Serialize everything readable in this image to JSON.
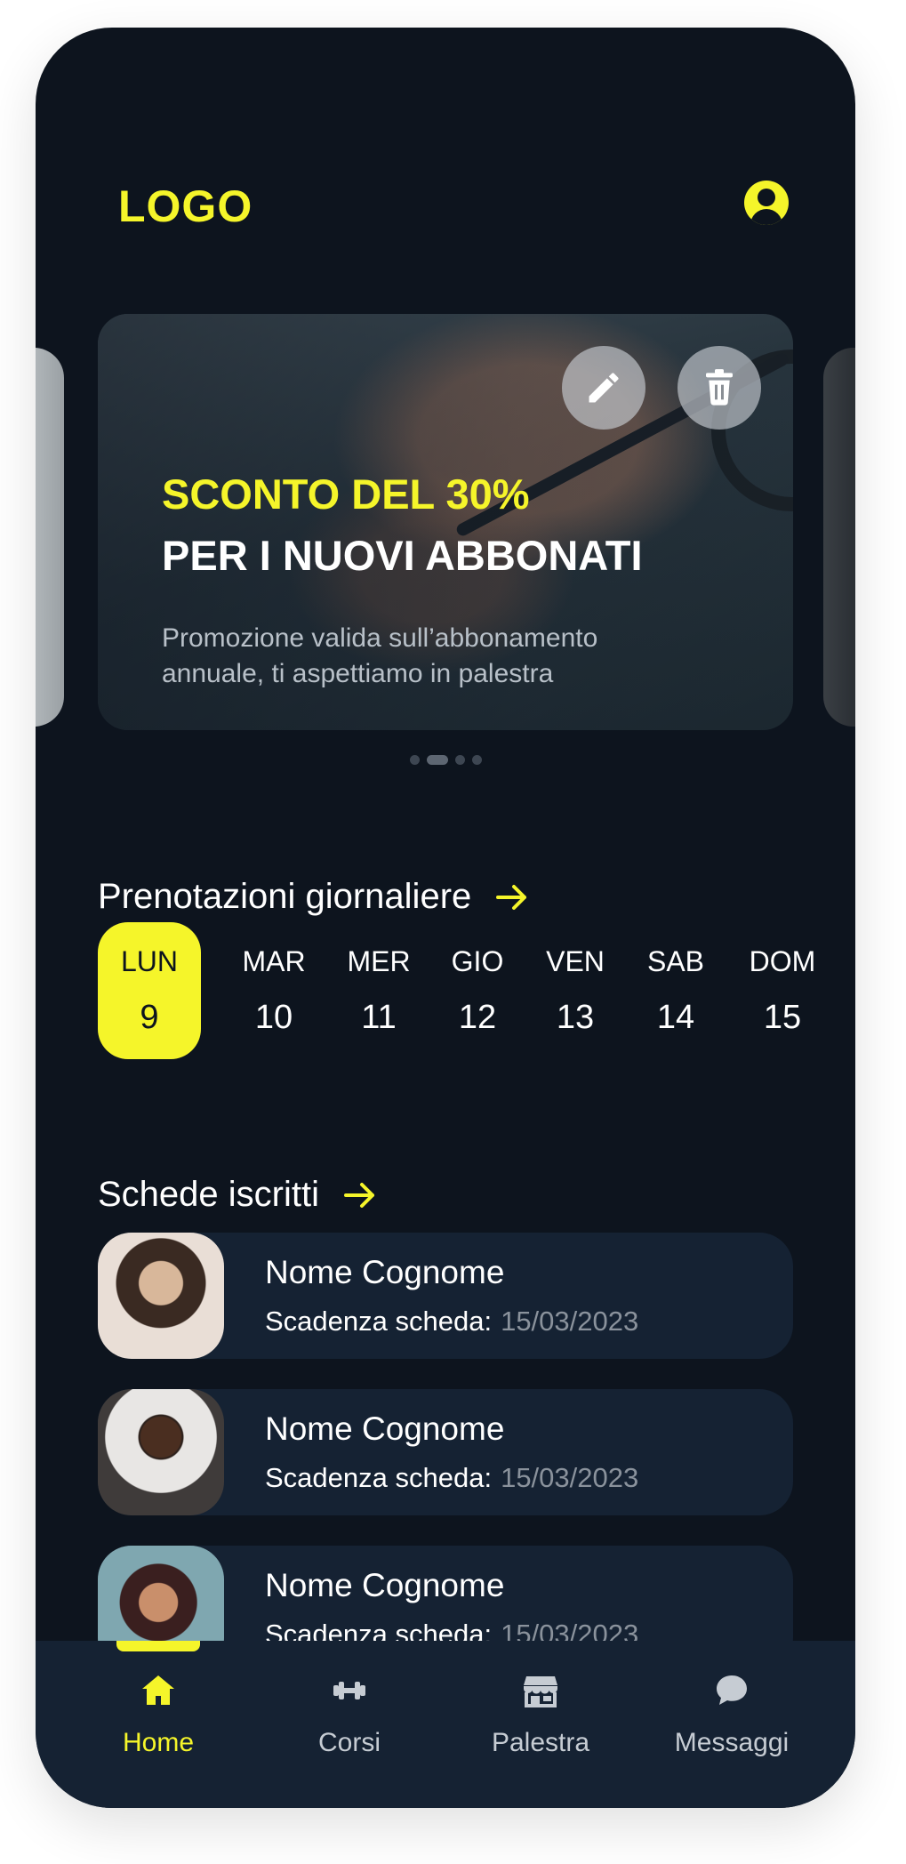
{
  "header": {
    "logo": "LOGO",
    "profile_icon": "user-circle-icon"
  },
  "carousel": {
    "active_index": 1,
    "total_slides": 4,
    "promo": {
      "title_highlight": "SCONTO DEL 30%",
      "title": "PER I NUOVI ABBONATI",
      "description": "Promozione valida sull’abbonamento annuale, ti aspettiamo in palestra"
    },
    "actions": {
      "edit_icon": "pencil-icon",
      "delete_icon": "trash-icon"
    }
  },
  "bookings": {
    "title": "Prenotazioni giornaliere",
    "days": [
      {
        "name": "LUN",
        "number": "9",
        "active": true
      },
      {
        "name": "MAR",
        "number": "10"
      },
      {
        "name": "MER",
        "number": "11"
      },
      {
        "name": "GIO",
        "number": "12"
      },
      {
        "name": "VEN",
        "number": "13"
      },
      {
        "name": "SAB",
        "number": "14"
      },
      {
        "name": "DOM",
        "number": "15"
      }
    ]
  },
  "members": {
    "title": "Schede iscritti",
    "items": [
      {
        "name": "Nome Cognome",
        "expiry_label": "Scadenza scheda:",
        "expiry_date": "15/03/2023"
      },
      {
        "name": "Nome Cognome",
        "expiry_label": "Scadenza scheda:",
        "expiry_date": "15/03/2023"
      },
      {
        "name": "Nome Cognome",
        "expiry_label": "Scadenza scheda:",
        "expiry_date": "15/03/2023"
      }
    ]
  },
  "nav": {
    "items": [
      {
        "label": "Home",
        "icon": "home-icon",
        "active": true
      },
      {
        "label": "Corsi",
        "icon": "dumbbell-icon"
      },
      {
        "label": "Palestra",
        "icon": "store-icon"
      },
      {
        "label": "Messaggi",
        "icon": "chat-icon"
      }
    ]
  },
  "colors": {
    "accent": "#f5f52a",
    "background": "#0d141e",
    "card": "#152233"
  }
}
